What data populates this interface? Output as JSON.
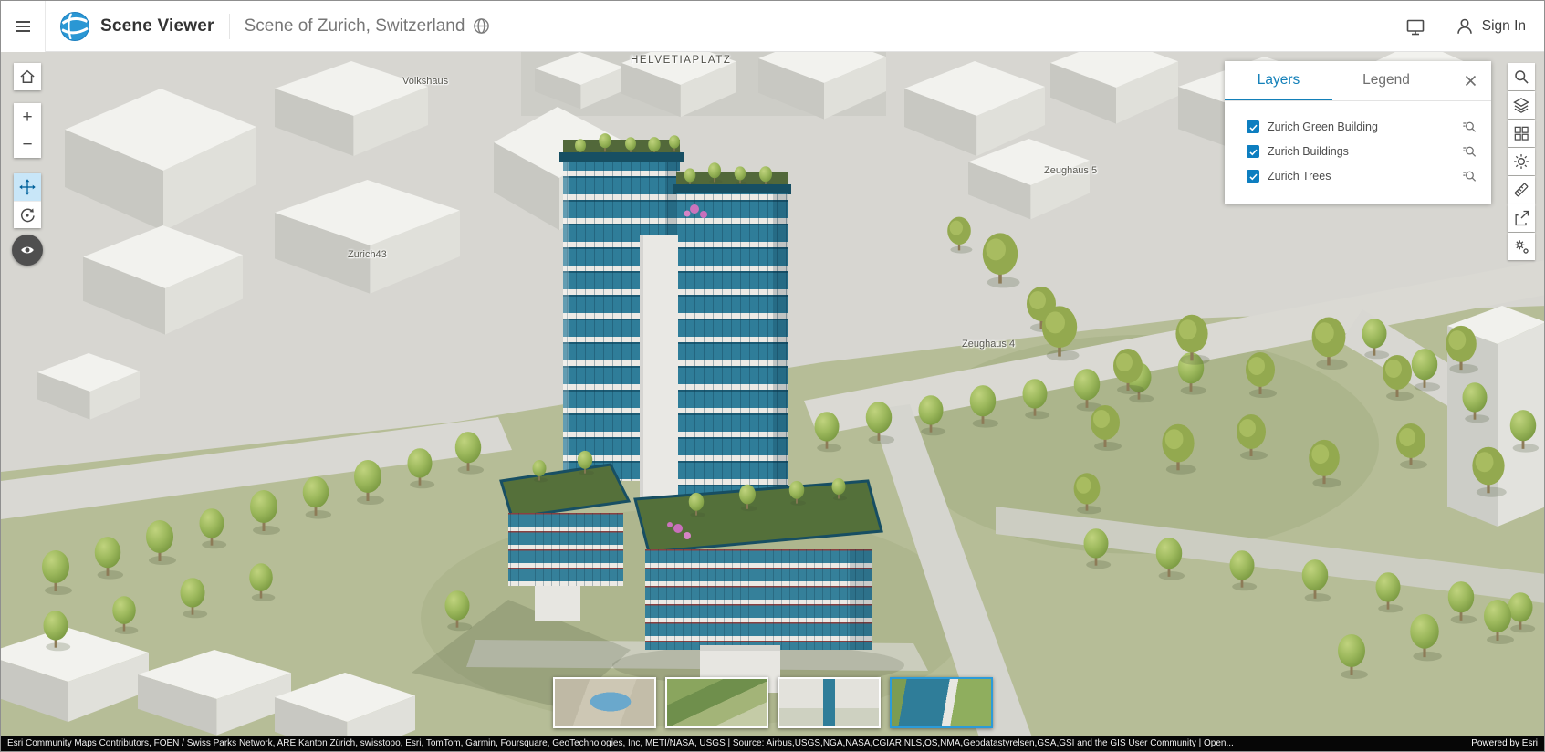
{
  "header": {
    "app_title": "Scene Viewer",
    "scene_title": "Scene of Zurich, Switzerland",
    "sign_in_label": "Sign In"
  },
  "toolbar_left": {
    "zoom_in": "+",
    "zoom_out": "−"
  },
  "layers_panel": {
    "tabs": [
      {
        "label": "Layers",
        "active": true
      },
      {
        "label": "Legend",
        "active": false
      }
    ],
    "layers": [
      {
        "label": "Zurich Green Building",
        "checked": true
      },
      {
        "label": "Zurich Buildings",
        "checked": true
      },
      {
        "label": "Zurich Trees",
        "checked": true
      }
    ]
  },
  "map": {
    "labels": [
      "HELVETIAPLATZ",
      "Volkshaus",
      "Zurich43",
      "Zeughaus 5",
      "Zeughaus 4"
    ]
  },
  "slides": {
    "count": 4,
    "selected_index": 3
  },
  "attribution": {
    "text": "Esri Community Maps Contributors, FOEN / Swiss Parks Network, ARE Kanton Zürich, swisstopo, Esri, TomTom, Garmin, Foursquare, GeoTechnologies, Inc, METI/NASA, USGS | Source: Airbus,USGS,NGA,NASA,CGIAR,NLS,OS,NMA,Geodatastyrelsen,GSA,GSI and the GIS User Community | Open...",
    "powered_by": "Powered by Esri"
  },
  "colors": {
    "accent_blue": "#0d7ec0",
    "active_tool_bg": "#c8e6f8",
    "attribution_bg": "#060606",
    "tower_glass": "#2f7d99",
    "tree_green": "#9cb85c"
  }
}
